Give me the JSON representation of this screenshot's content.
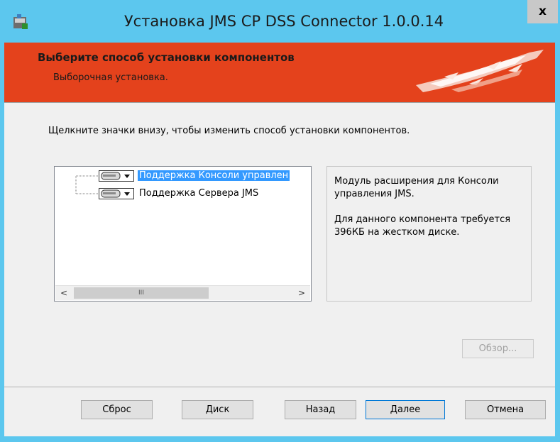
{
  "window": {
    "title": "Установка JMS CP DSS Connector 1.0.0.14",
    "close_label": "x"
  },
  "banner": {
    "title": "Выберите способ установки компонентов",
    "subtitle": "Выборочная установка."
  },
  "instruction": "Щелкните значки внизу, чтобы изменить способ установки компонентов.",
  "tree": {
    "items": [
      {
        "label": "Поддержка Консоли управлен",
        "selected": true
      },
      {
        "label": "Поддержка Сервера JMS",
        "selected": false
      }
    ],
    "scroll_left": "<",
    "scroll_right": ">",
    "scroll_thumb": "III"
  },
  "description": {
    "line1": "Модуль расширения для Консоли управления JMS.",
    "line2": "Для данного компонента требуется 396КБ на жестком диске."
  },
  "buttons": {
    "browse": "Обзор...",
    "reset": "Сброс",
    "disk": "Диск",
    "back": "Назад",
    "next": "Далее",
    "cancel": "Отмена"
  },
  "colors": {
    "titlebar": "#5cc7ee",
    "banner": "#e4421c",
    "selection": "#3399ff",
    "dialog_bg": "#f0f0f0"
  }
}
